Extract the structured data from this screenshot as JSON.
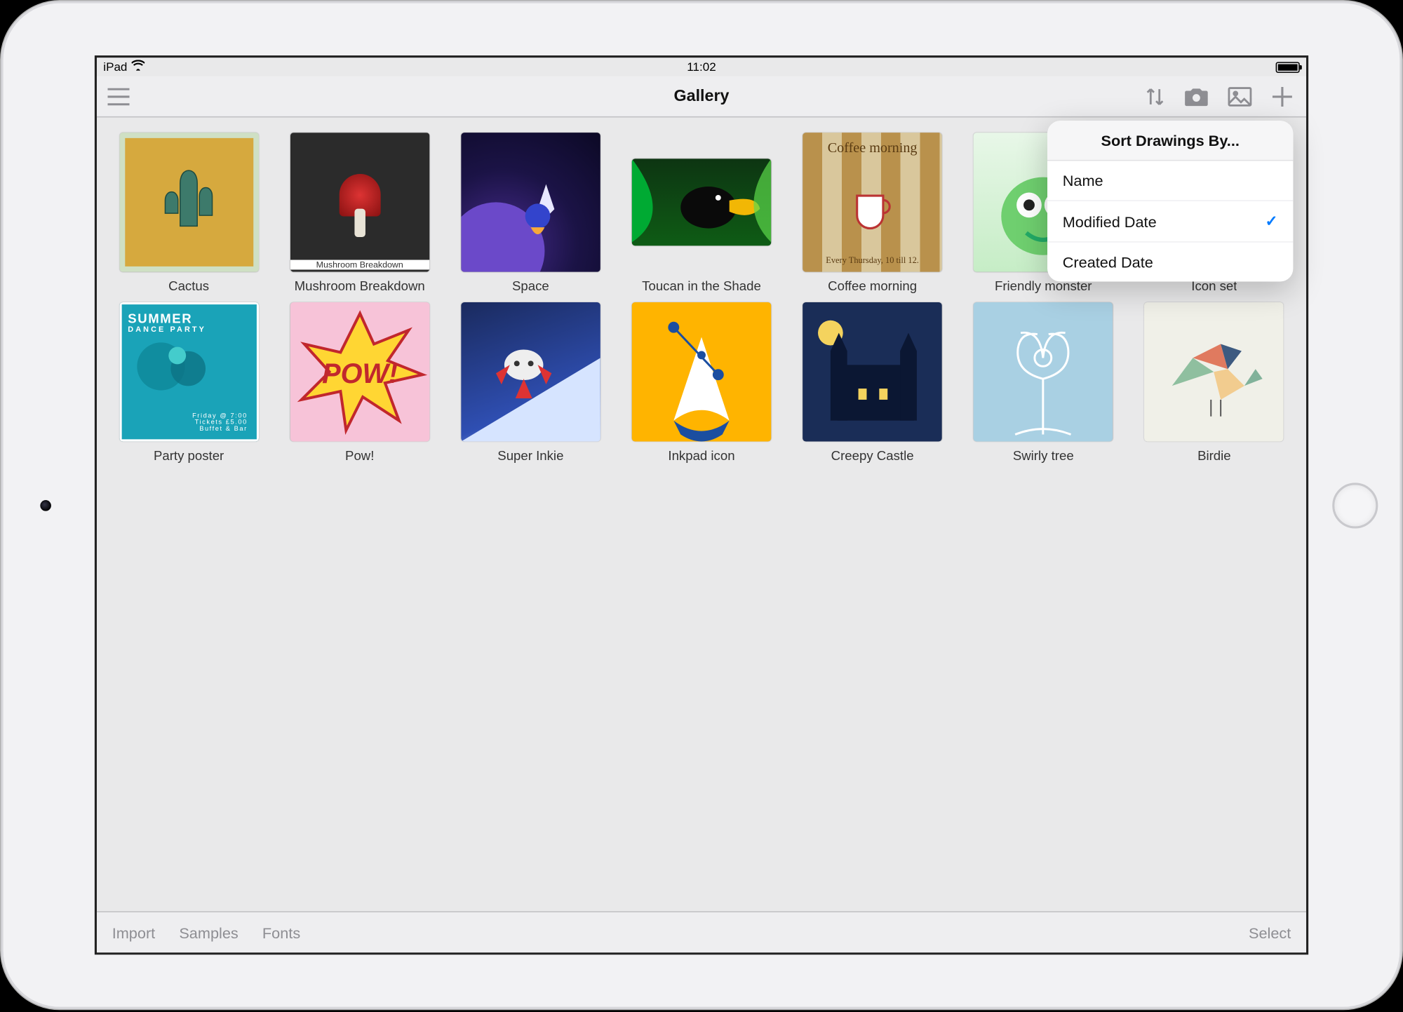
{
  "statusbar": {
    "device": "iPad",
    "time": "11:02"
  },
  "navbar": {
    "title": "Gallery",
    "icons": {
      "menu": "menu-icon",
      "sort": "sort-icon",
      "camera": "camera-icon",
      "photo": "photo-icon",
      "add": "add-icon"
    }
  },
  "popover": {
    "title": "Sort Drawings By...",
    "options": [
      {
        "label": "Name",
        "selected": false
      },
      {
        "label": "Modified Date",
        "selected": true
      },
      {
        "label": "Created Date",
        "selected": false
      }
    ]
  },
  "toolbar": {
    "import": "Import",
    "samples": "Samples",
    "fonts": "Fonts",
    "select": "Select"
  },
  "drawings": [
    {
      "title": "Cactus",
      "style": "t-cactus"
    },
    {
      "title": "Mushroom Breakdown",
      "style": "t-mushroom"
    },
    {
      "title": "Space",
      "style": "t-space"
    },
    {
      "title": "Toucan in the Shade",
      "style": "t-toucan"
    },
    {
      "title": "Coffee morning",
      "style": "t-coffee"
    },
    {
      "title": "Friendly monster",
      "style": "t-monster"
    },
    {
      "title": "Icon set",
      "style": "t-iconset"
    },
    {
      "title": "Party poster",
      "style": "t-party"
    },
    {
      "title": "Pow!",
      "style": "t-pow"
    },
    {
      "title": "Super Inkie",
      "style": "t-inkie"
    },
    {
      "title": "Inkpad icon",
      "style": "t-inkpad"
    },
    {
      "title": "Creepy Castle",
      "style": "t-castle"
    },
    {
      "title": "Swirly tree",
      "style": "t-swirly"
    },
    {
      "title": "Birdie",
      "style": "t-birdie"
    }
  ],
  "thumb_text": {
    "coffee_top": "Coffee morning",
    "coffee_bot": "Every Thursday, 10 till 12.",
    "mushroom": "Mushroom Breakdown",
    "party_top": "SUMMER",
    "party_sub": "DANCE PARTY",
    "party_foot": "Friday @ 7:00\nTickets £5.00\nBuffet & Bar",
    "pow": "POW!"
  }
}
